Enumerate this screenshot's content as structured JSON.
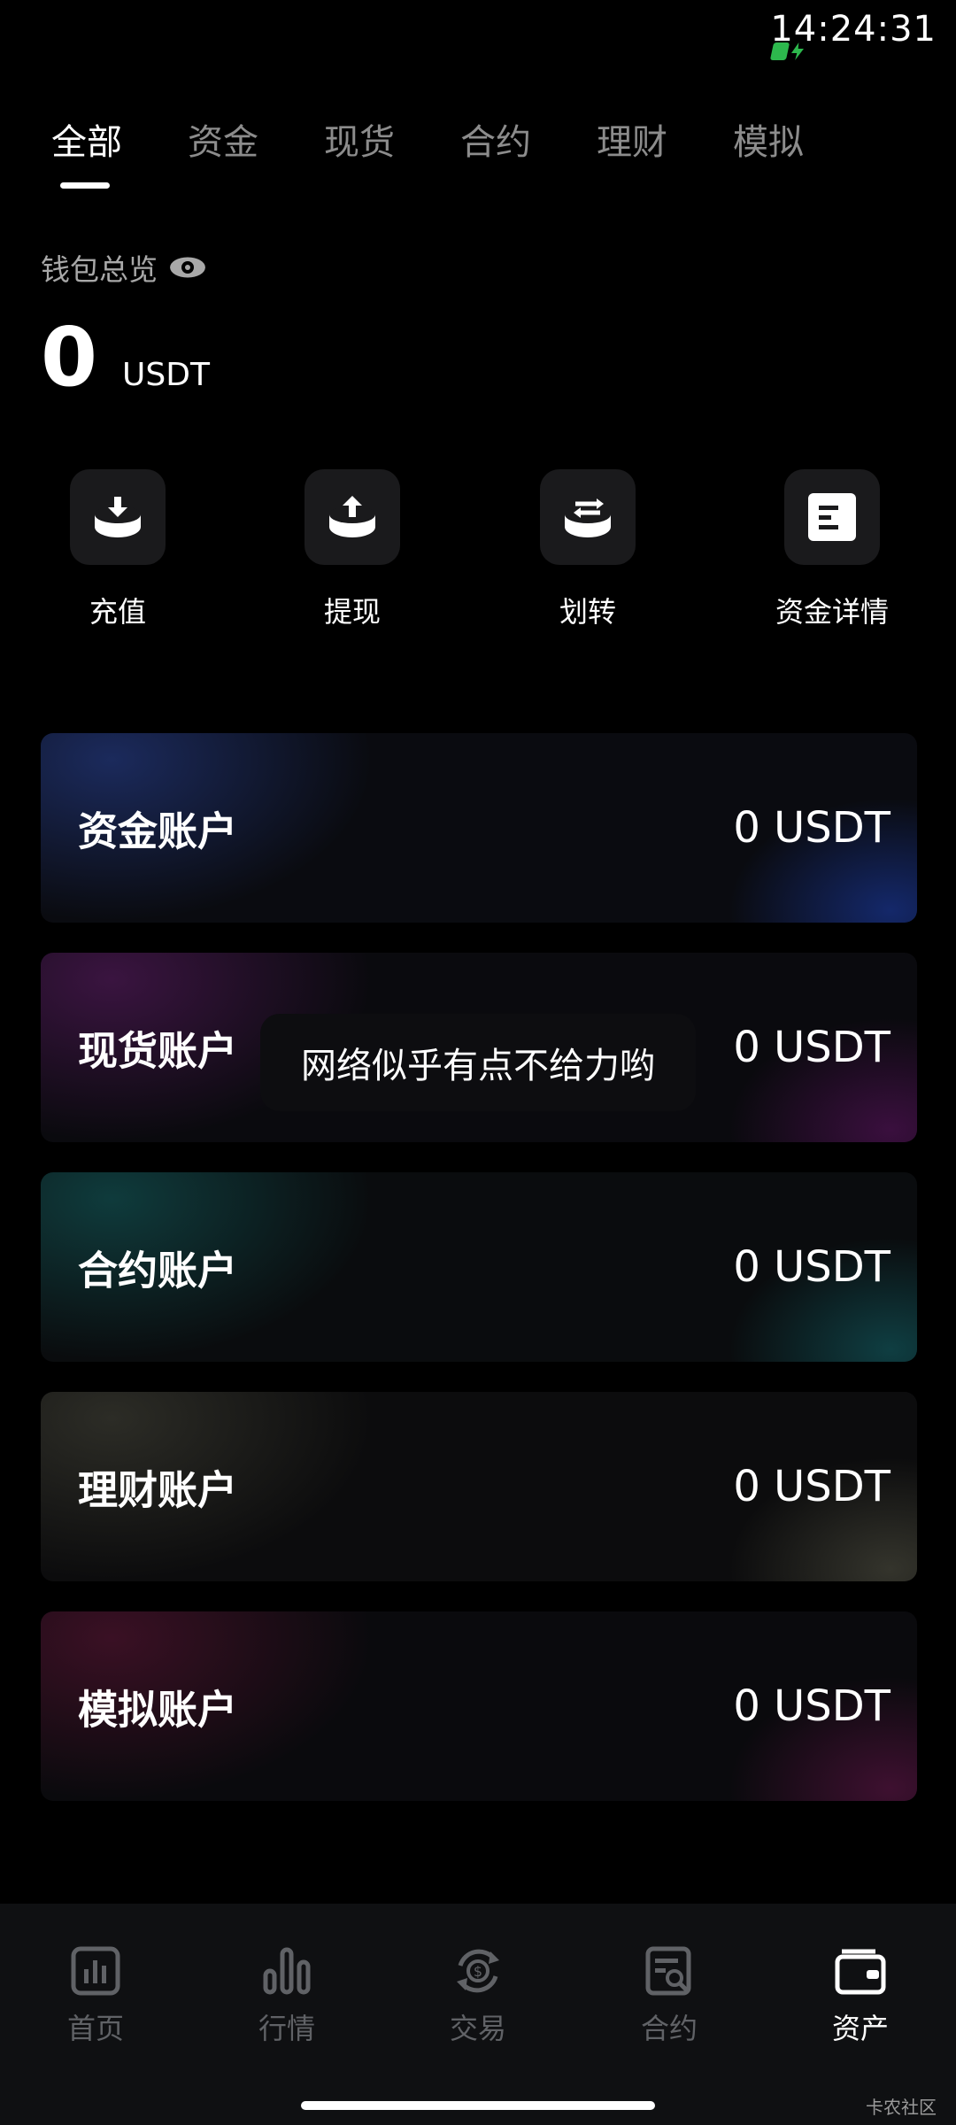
{
  "status_bar": {
    "time": "14:24:31"
  },
  "tabs": [
    {
      "label": "全部",
      "active": true
    },
    {
      "label": "资金",
      "active": false
    },
    {
      "label": "现货",
      "active": false
    },
    {
      "label": "合约",
      "active": false
    },
    {
      "label": "理财",
      "active": false
    },
    {
      "label": "模拟",
      "active": false
    }
  ],
  "overview": {
    "label": "钱包总览",
    "total_value": "0",
    "total_unit": "USDT"
  },
  "actions": [
    {
      "label": "充值",
      "icon": "deposit-icon"
    },
    {
      "label": "提现",
      "icon": "withdraw-icon"
    },
    {
      "label": "划转",
      "icon": "transfer-icon"
    },
    {
      "label": "资金详情",
      "icon": "funds-detail-icon"
    }
  ],
  "accounts": [
    {
      "name": "资金账户",
      "value": "0 USDT",
      "accent": "#1b2a5c"
    },
    {
      "name": "现货账户",
      "value": "0 USDT",
      "accent": "#3a1440"
    },
    {
      "name": "合约账户",
      "value": "0 USDT",
      "accent": "#0f3b3c"
    },
    {
      "name": "理财账户",
      "value": "0 USDT",
      "accent": "#2c2c26"
    },
    {
      "name": "模拟账户",
      "value": "0 USDT",
      "accent": "#3a1024"
    }
  ],
  "toast": {
    "message": "网络似乎有点不给力哟"
  },
  "bottom_nav": [
    {
      "label": "首页",
      "icon": "home-chart-icon",
      "active": false
    },
    {
      "label": "行情",
      "icon": "market-bars-icon",
      "active": false
    },
    {
      "label": "交易",
      "icon": "trade-exchange-icon",
      "active": false
    },
    {
      "label": "合约",
      "icon": "contract-document-icon",
      "active": false
    },
    {
      "label": "资产",
      "icon": "wallet-icon",
      "active": true
    }
  ],
  "watermark": "卡农社区",
  "colors": {
    "background": "#000000",
    "nav_bg": "#0f1012",
    "inactive": "#606266",
    "tab_inactive": "#8c8c8c",
    "status_green": "#2db84d"
  }
}
